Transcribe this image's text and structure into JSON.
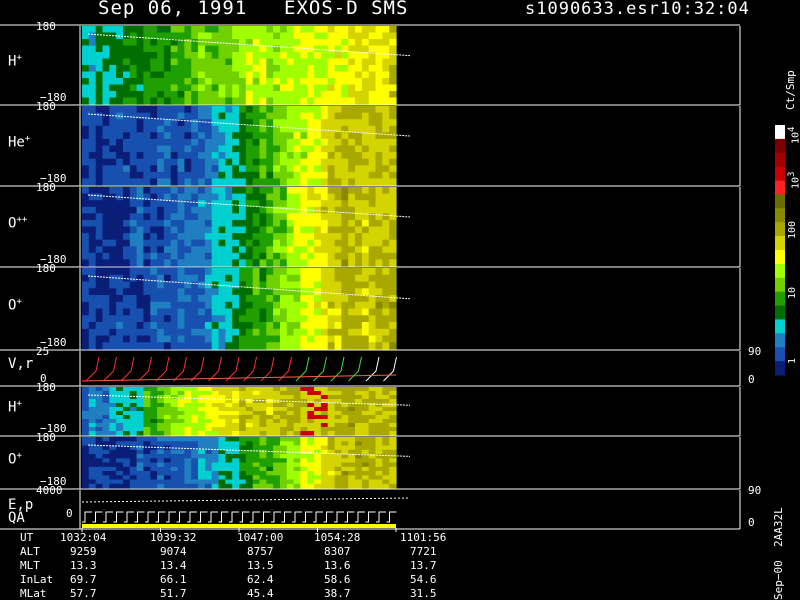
{
  "header": {
    "date": "Sep 06, 1991",
    "instrument": "EXOS-D SMS",
    "file": "s1090633.esr",
    "time": "10:32:04"
  },
  "panels": [
    {
      "label": "H",
      "sup": "+",
      "ymax": "180",
      "ymin": "−180"
    },
    {
      "label": "He",
      "sup": "+",
      "ymax": "180",
      "ymin": "−180"
    },
    {
      "label": "O",
      "sup": "++",
      "ymax": "180",
      "ymin": "−180"
    },
    {
      "label": "O",
      "sup": "+",
      "ymax": "180",
      "ymin": "−180"
    },
    {
      "label": "V,r",
      "sup": "",
      "ymax": "25",
      "ymin": "0",
      "rmax": "90",
      "rmin": "0"
    },
    {
      "label": "H",
      "sup": "+",
      "ymax": "180",
      "ymin": "−180"
    },
    {
      "label": "O",
      "sup": "+",
      "ymax": "180",
      "ymin": "−180"
    },
    {
      "label": "E,p",
      "sup": "",
      "ymax": "4000",
      "ymin": "",
      "rmax": "90",
      "rmin": "0"
    }
  ],
  "qa_label": "QA",
  "qa_zero": "0",
  "colorbar": {
    "unit": "Ct/Smp",
    "ticks": [
      {
        "label": "10",
        "sup": "4"
      },
      {
        "label": "10",
        "sup": "3"
      },
      {
        "label": "100",
        "sup": ""
      },
      {
        "label": "10",
        "sup": ""
      },
      {
        "label": "1",
        "sup": ""
      }
    ],
    "colors": [
      "#ffffff",
      "#7a0000",
      "#a00000",
      "#c80000",
      "#ff2020",
      "#6b6b00",
      "#8a8a00",
      "#a8a800",
      "#d4d400",
      "#ffff00",
      "#a0ff00",
      "#70d000",
      "#20a000",
      "#006e00",
      "#00d0d0",
      "#1f7fc0",
      "#1850b0",
      "#0a1e78"
    ]
  },
  "side_note": "Sep−00  2AA32L",
  "footer": {
    "row_labels": [
      "UT",
      "ALT",
      "MLT",
      "InLat",
      "MLat"
    ],
    "columns": [
      [
        "1032:04",
        "9259",
        "13.3",
        "69.7",
        "57.7"
      ],
      [
        "1039:32",
        "9074",
        "13.4",
        "66.1",
        "51.7"
      ],
      [
        "1047:00",
        "8757",
        "13.5",
        "62.4",
        "45.4"
      ],
      [
        "1054:28",
        "8307",
        "13.6",
        "58.6",
        "38.7"
      ],
      [
        "1101:56",
        "7721",
        "13.7",
        "54.6",
        "31.5"
      ]
    ]
  },
  "chart_data": {
    "type": "heatmap",
    "title": "Sep 06, 1991   EXOS-D SMS",
    "x_ticks": [
      "1032:04",
      "1039:32",
      "1047:00",
      "1054:28",
      "1101:56"
    ],
    "y_range_pitch_angle": [
      -180,
      180
    ],
    "colorbar_scale": "log",
    "colorbar_range": [
      1,
      10000
    ],
    "series": [
      {
        "name": "H+",
        "dominant_level": "from blue/cyan at start through green/olive to yellow-green at end"
      },
      {
        "name": "He+",
        "dominant_level": "dark blue at start, cyan/green middle, yellow and olive near end"
      },
      {
        "name": "O++",
        "dominant_level": "dark blue at start, cyan/green middle, olive/yellow near end"
      },
      {
        "name": "O+",
        "dominant_level": "dark blue at start, cyan/green middle, olive/yellow near end"
      },
      {
        "name": "H+ (2)",
        "dominant_level": "blue/cyan at start, olive middle with red bursts, yellow near end"
      },
      {
        "name": "O+ (2)",
        "dominant_level": "blue at start, green/olive middle, olive/yellow near end"
      }
    ]
  }
}
